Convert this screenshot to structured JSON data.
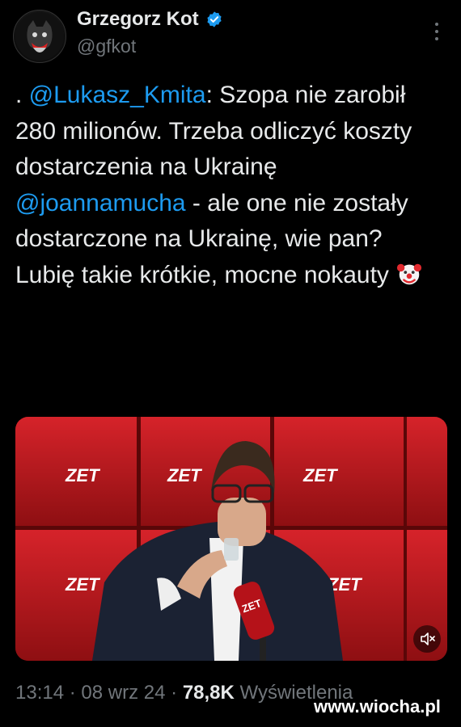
{
  "author": {
    "display_name": "Grzegorz Kot",
    "handle": "@gfkot",
    "verified_color": "#1d9bf0"
  },
  "tweet": {
    "prefix": ". ",
    "mention1": "@Lukasz_Kmita",
    "line1_rest": ":  Szopa nie zarobił 280 milionów. Trzeba odliczyć koszty dostarczenia na Ukrainę",
    "mention2": "@joannamucha",
    "line2_rest": " - ale one nie zostały dostarczone na Ukrainę, wie pan?",
    "line3": "Lubię takie krótkie, mocne nokauty",
    "emoji": "clown-face"
  },
  "media": {
    "logo_text": "ZET",
    "mic_text": "ZET",
    "mute_icon": "speaker-muted-icon"
  },
  "meta": {
    "time": "13:14",
    "date": "08 wrz 24",
    "views_count": "78,8K",
    "views_label": "Wyświetlenia",
    "separator": "·"
  },
  "watermark": "www.wiocha.pl",
  "colors": {
    "background": "#000000",
    "text": "#e7e9ea",
    "secondary": "#71767b",
    "link": "#1d9bf0",
    "studio_red": "#c4161c"
  }
}
